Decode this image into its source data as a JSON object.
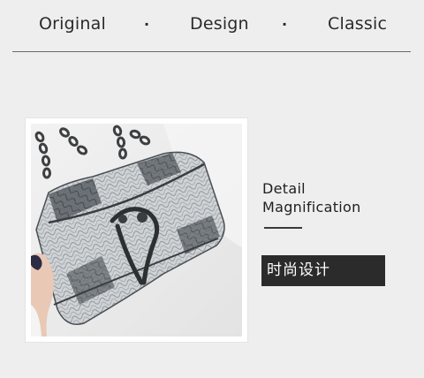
{
  "header": {
    "word_1": "Original",
    "separator_1": "·",
    "word_2": "Design",
    "separator_2": "·",
    "word_3": "Classic"
  },
  "detail": {
    "title_line_1": "Detail",
    "title_line_2": "Magnification",
    "badge_text": "时尚设计"
  },
  "colors": {
    "background": "#eeeeee",
    "text": "#2a2a2a",
    "badge_bg": "#2b2b2b",
    "badge_text": "#ffffff",
    "snakeskin_dark": "#4f5459",
    "snakeskin_light": "#d9dcdf"
  }
}
